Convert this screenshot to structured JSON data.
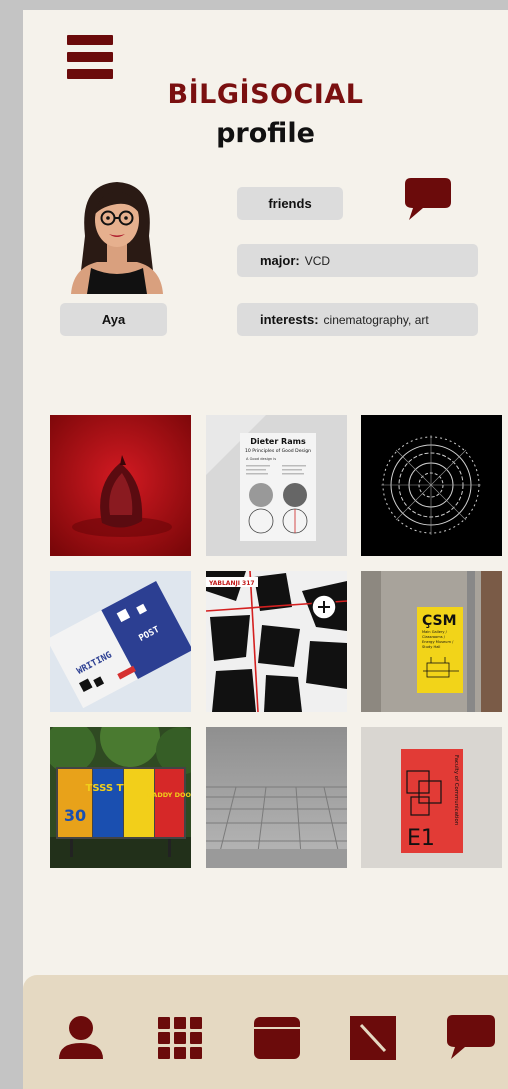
{
  "app": {
    "brand": "BİLGİSOCIAL",
    "subtitle": "profile"
  },
  "profile": {
    "name": "Aya",
    "friends_label": "friends",
    "major_label": "major:",
    "major_value": "VCD",
    "interests_label": "interests:",
    "interests_value": "cinematography, art"
  },
  "gallery": {
    "items": [
      {
        "name": "red-fruit-photo"
      },
      {
        "name": "dieter-rams-poster",
        "title": "Dieter Rams",
        "subtitle": "10 Principles of Good Design",
        "caption": "A Good design is"
      },
      {
        "name": "radial-pattern-artwork"
      },
      {
        "name": "typography-brochure",
        "text_a": "WRITING",
        "text_b": "POST"
      },
      {
        "name": "map-poster",
        "title": "YABLANJI 317"
      },
      {
        "name": "csm-signage",
        "title": "ÇSM",
        "lines": [
          "Main Gallery /",
          "Classrooms /",
          "Energy Museum /",
          "Study Hall"
        ]
      },
      {
        "name": "billboard-posters",
        "poster_a": "TSSS TT",
        "poster_b": "DADDY DOO",
        "poster_c": "30"
      },
      {
        "name": "maze-render"
      },
      {
        "name": "faculty-signage",
        "label": "E1",
        "side_text": "Faculty of Communication"
      }
    ]
  },
  "nav": {
    "items": [
      "profile-icon",
      "grid-icon",
      "window-icon",
      "edit-icon",
      "chat-icon"
    ]
  },
  "colors": {
    "accent": "#6b0b0b",
    "background": "#f5f2eb",
    "nav_bg": "#e5d9c2",
    "pill_bg": "#dcdcdc"
  }
}
